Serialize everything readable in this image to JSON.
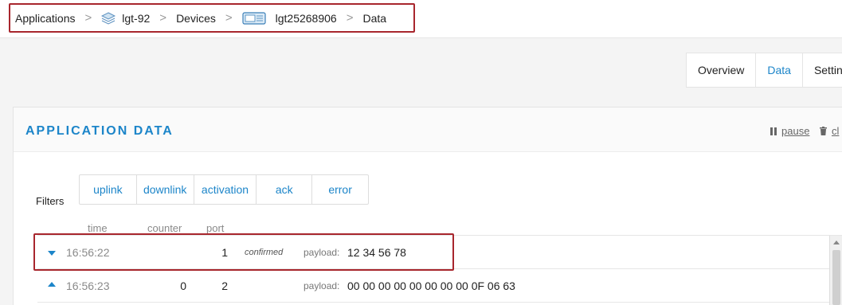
{
  "breadcrumb": {
    "items": [
      {
        "label": "Applications",
        "icon": ""
      },
      {
        "label": "lgt-92",
        "icon": "stack-icon"
      },
      {
        "label": "Devices",
        "icon": ""
      },
      {
        "label": "lgt25268906",
        "icon": "device-icon"
      },
      {
        "label": "Data",
        "icon": ""
      }
    ],
    "separator": ">"
  },
  "tabs": [
    {
      "label": "Overview",
      "active": false
    },
    {
      "label": "Data",
      "active": true
    },
    {
      "label": "Settin",
      "active": false
    }
  ],
  "panel": {
    "title": "APPLICATION DATA",
    "pause_label": "pause",
    "clear_label": "cl"
  },
  "filters": {
    "label": "Filters",
    "buttons": [
      "uplink",
      "downlink",
      "activation",
      "ack",
      "error"
    ]
  },
  "columns": {
    "time": "time",
    "counter": "counter",
    "port": "port"
  },
  "rows": [
    {
      "direction": "down",
      "time": "16:56:22",
      "counter": "",
      "port": "1",
      "confirmed": "confirmed",
      "payload_label": "payload:",
      "payload": "12 34 56 78"
    },
    {
      "direction": "up",
      "time": "16:56:23",
      "counter": "0",
      "port": "2",
      "confirmed": "",
      "payload_label": "payload:",
      "payload": "00 00 00 00 00 00 00 00 0F 06 63"
    }
  ],
  "colors": {
    "accent": "#1c85c9",
    "highlight": "#a8262d"
  }
}
